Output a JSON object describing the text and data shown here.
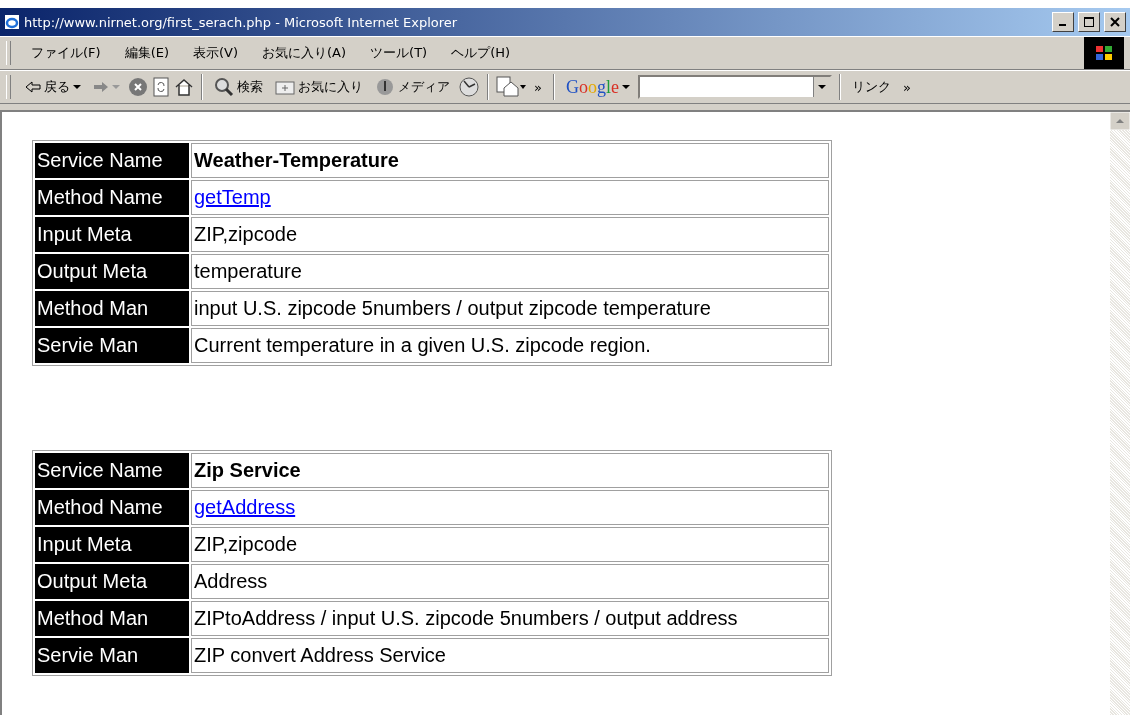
{
  "window": {
    "title": "http://www.nirnet.org/first_serach.php - Microsoft Internet Explorer"
  },
  "menu": [
    "ファイル(F)",
    "編集(E)",
    "表示(V)",
    "お気に入り(A)",
    "ツール(T)",
    "ヘルプ(H)"
  ],
  "toolbar": {
    "back": "戻る",
    "search": "検索",
    "favorites": "お気に入り",
    "media": "メディア",
    "more": "»",
    "google": "Google",
    "links": "リンク",
    "links_more": "»"
  },
  "services": [
    {
      "rows": [
        {
          "kind": "name",
          "label": "Service Name",
          "value": "Weather-Temperature"
        },
        {
          "kind": "link",
          "label": "Method Name",
          "value": "getTemp"
        },
        {
          "kind": "text",
          "label": "Input Meta",
          "value": "ZIP,zipcode"
        },
        {
          "kind": "text",
          "label": "Output Meta",
          "value": "temperature"
        },
        {
          "kind": "text",
          "label": "Method Man",
          "value": "input U.S. zipcode 5numbers / output zipcode temperature"
        },
        {
          "kind": "text",
          "label": "Servie Man",
          "value": "Current temperature in a given U.S. zipcode region."
        }
      ]
    },
    {
      "rows": [
        {
          "kind": "name",
          "label": "Service Name",
          "value": "Zip Service"
        },
        {
          "kind": "link",
          "label": "Method Name",
          "value": "getAddress"
        },
        {
          "kind": "text",
          "label": "Input Meta",
          "value": "ZIP,zipcode"
        },
        {
          "kind": "text",
          "label": "Output Meta",
          "value": "Address"
        },
        {
          "kind": "text",
          "label": "Method Man",
          "value": "ZIPtoAddress / input U.S. zipcode 5numbers / output address"
        },
        {
          "kind": "text",
          "label": "Servie Man",
          "value": "ZIP convert Address Service"
        }
      ]
    }
  ]
}
